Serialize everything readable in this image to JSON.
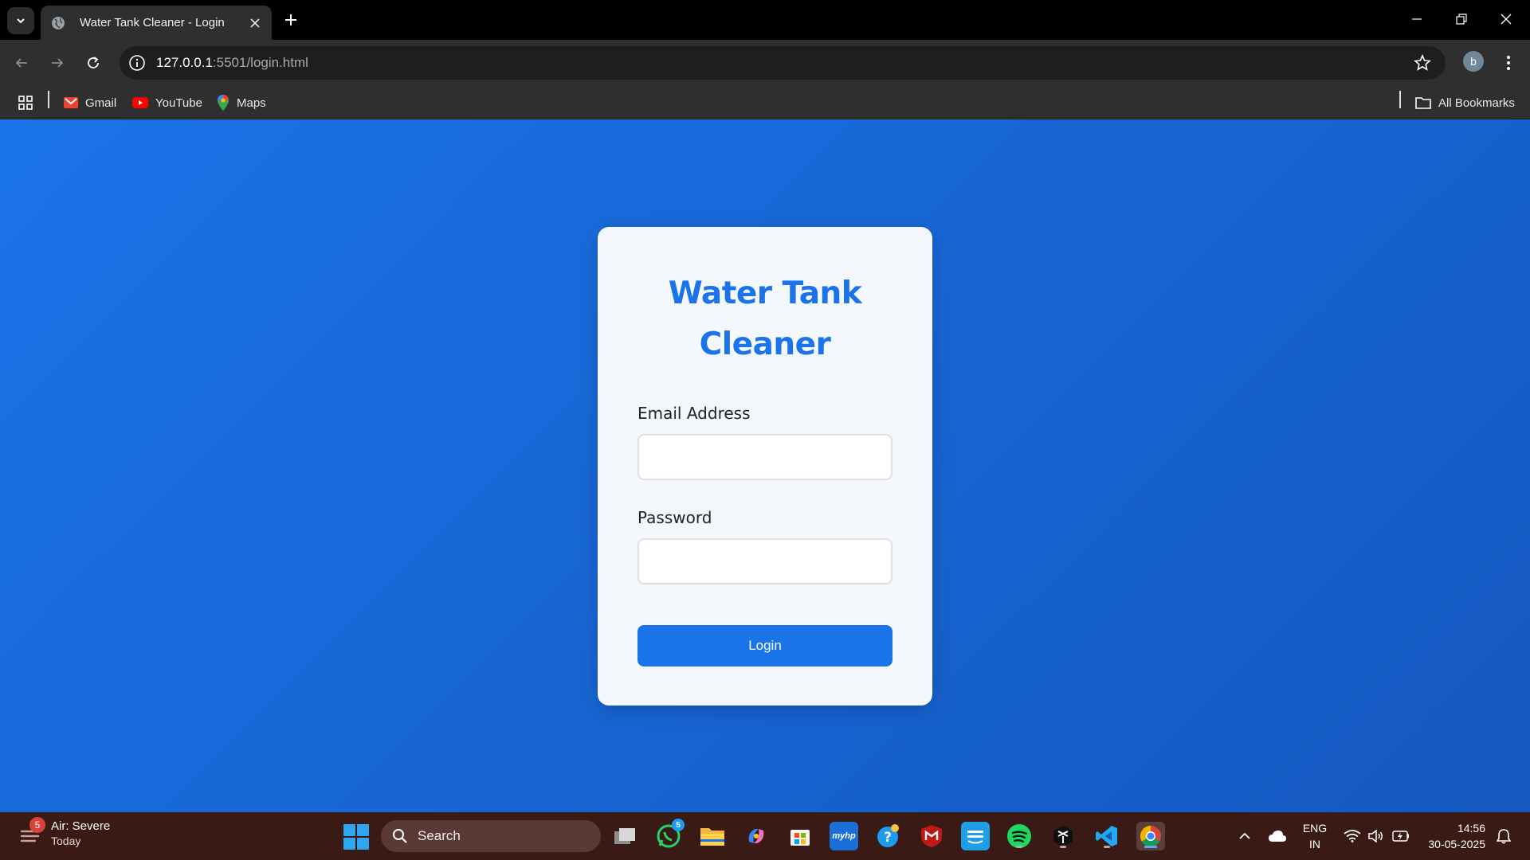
{
  "browser": {
    "tab_title": "Water Tank Cleaner - Login",
    "url_host": "127.0.0.1",
    "url_path": ":5501/login.html",
    "profile_initial": "b",
    "bookmarks": [
      {
        "label": "Gmail",
        "icon": "gmail-icon"
      },
      {
        "label": "YouTube",
        "icon": "youtube-icon"
      },
      {
        "label": "Maps",
        "icon": "maps-icon"
      }
    ],
    "all_bookmarks_label": "All Bookmarks"
  },
  "login": {
    "title_line1": "Water Tank",
    "title_line2": "Cleaner",
    "email_label": "Email Address",
    "email_value": "",
    "password_label": "Password",
    "password_value": "",
    "button_label": "Login"
  },
  "taskbar": {
    "weather_title": "Air: Severe",
    "weather_subtitle": "Today",
    "weather_badge": "5",
    "search_placeholder": "Search",
    "whatsapp_badge": "5",
    "language_line1": "ENG",
    "language_line2": "IN",
    "time": "14:56",
    "date": "30-05-2025"
  },
  "colors": {
    "accent": "#1a73e8",
    "page_gradient_end": "#1558c0",
    "card_bg": "#f4f7fb",
    "taskbar_bg": "#3a1a14"
  }
}
